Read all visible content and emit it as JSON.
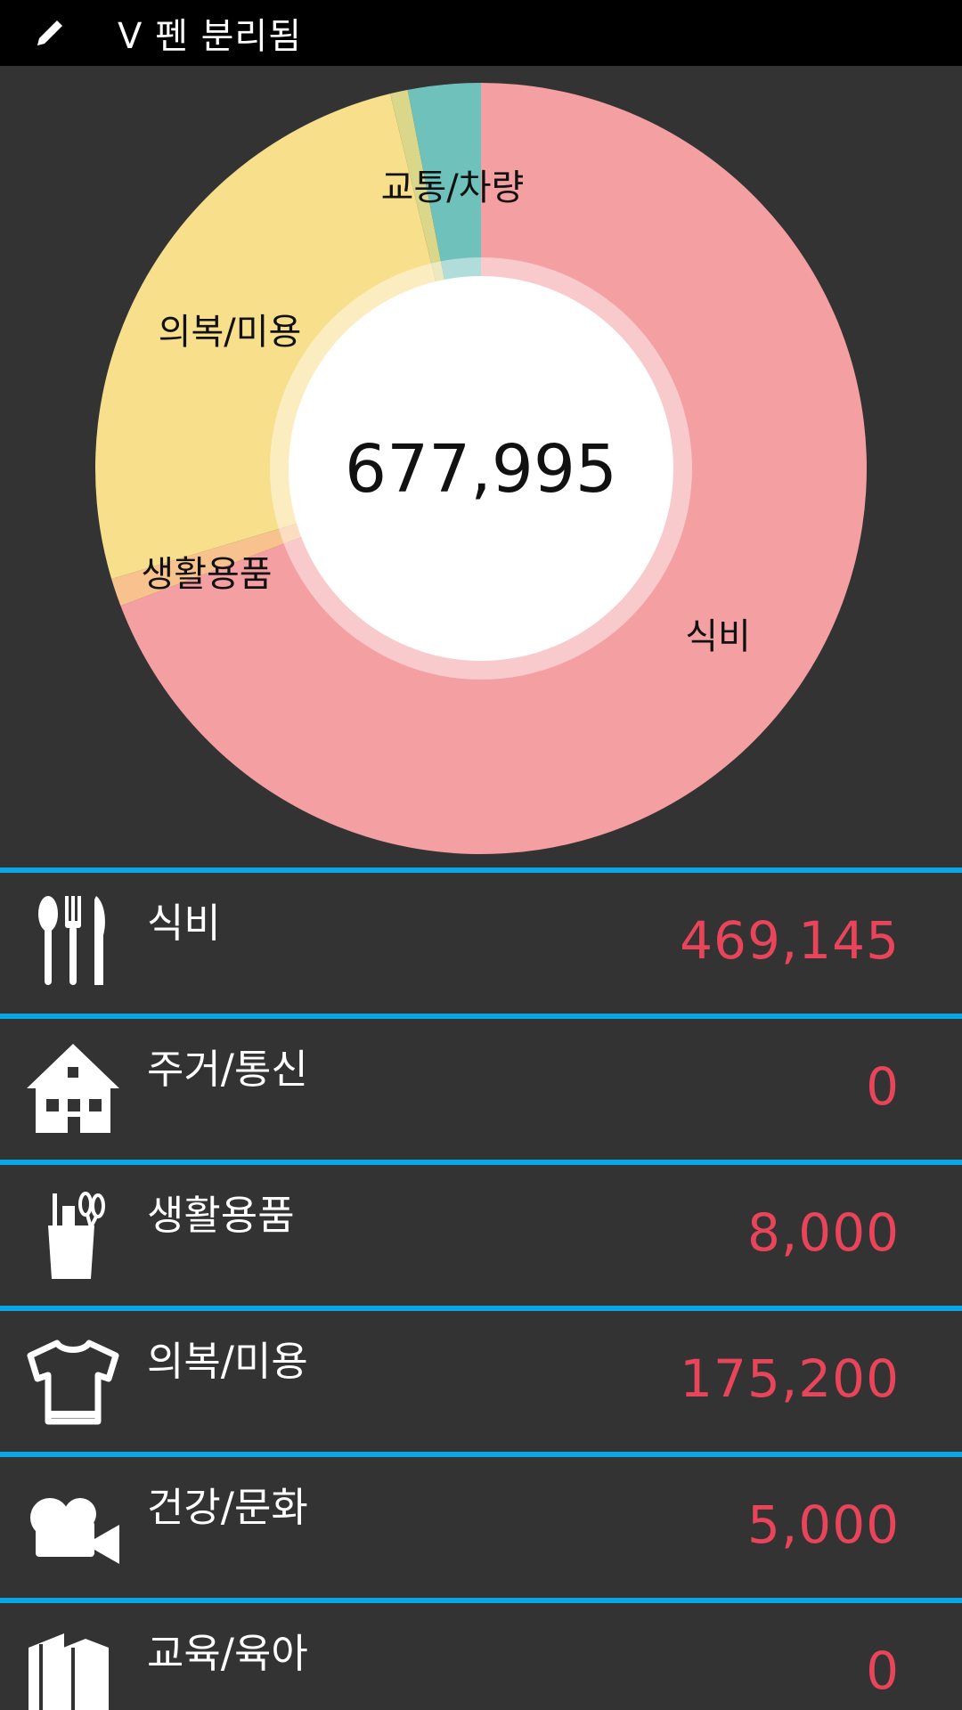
{
  "status_bar": {
    "text": "V 펜 분리됨",
    "icon": "pen-icon"
  },
  "total": "677,995",
  "chart_data": {
    "type": "pie",
    "title": "",
    "center_label": "677,995",
    "slices": [
      {
        "label": "식비",
        "value": 469145,
        "color": "#f49fa2"
      },
      {
        "label": "생활용품",
        "value": 8000,
        "color": "#f7c28e"
      },
      {
        "label": "의복/미용",
        "value": 175200,
        "color": "#f8df8c"
      },
      {
        "label": "",
        "value": 5000,
        "color": "#dbd78a"
      },
      {
        "label": "교통/차량",
        "value": 20650,
        "color": "#6fc2bc"
      }
    ]
  },
  "categories": [
    {
      "label": "식비",
      "amount": "469,145",
      "icon": "utensils-icon"
    },
    {
      "label": "주거/통신",
      "amount": "0",
      "icon": "house-icon"
    },
    {
      "label": "생활용품",
      "amount": "8,000",
      "icon": "supplies-cup-icon"
    },
    {
      "label": "의복/미용",
      "amount": "175,200",
      "icon": "tshirt-icon"
    },
    {
      "label": "건강/문화",
      "amount": "5,000",
      "icon": "video-camera-icon"
    },
    {
      "label": "교육/육아",
      "amount": "0",
      "icon": "books-icon"
    }
  ],
  "colors": {
    "accent_line": "#0aa6e6",
    "amount": "#e8445a",
    "background": "#333333"
  }
}
